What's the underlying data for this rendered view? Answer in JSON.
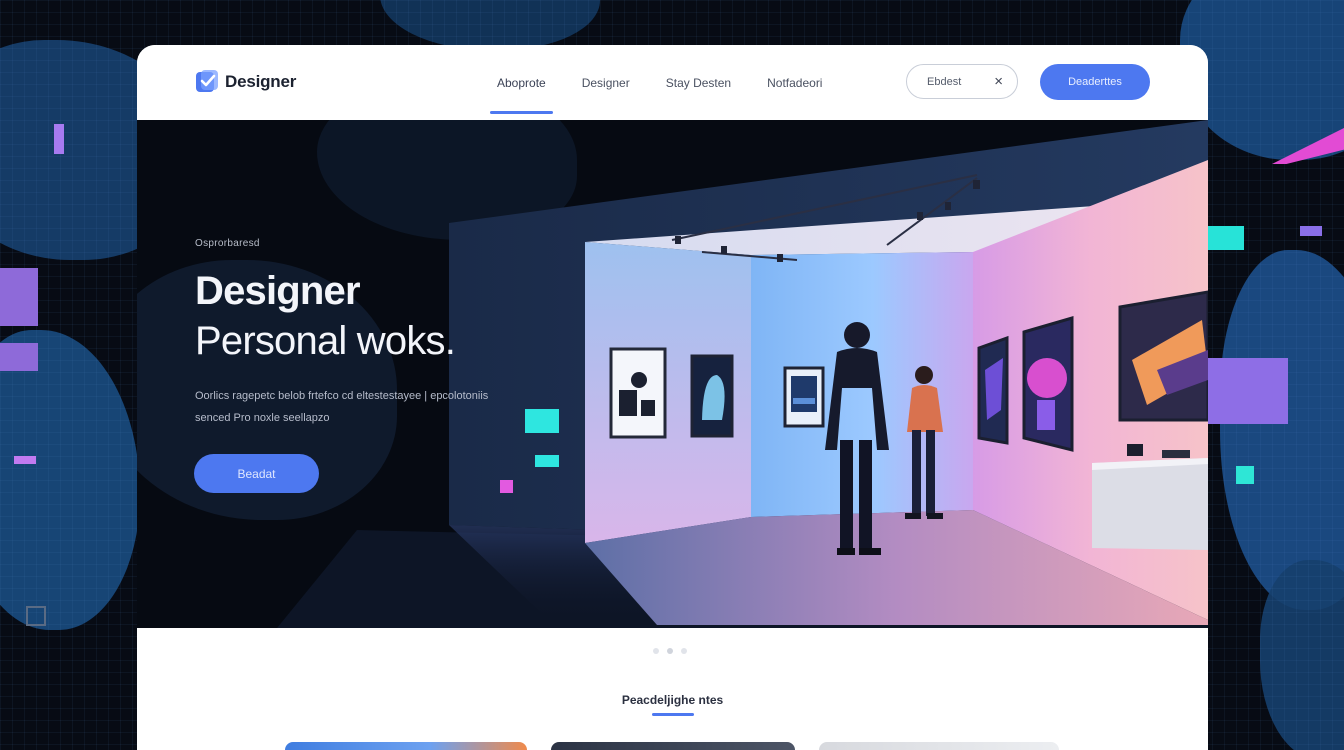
{
  "brand": {
    "name": "Designer",
    "accent_color": "#4d78f0",
    "logo_icon": "check-shield-icon"
  },
  "nav": {
    "links": [
      {
        "label": "Aboprote",
        "active": true
      },
      {
        "label": "Designer",
        "active": false
      },
      {
        "label": "Stay Desten",
        "active": false
      },
      {
        "label": "Notfadeori",
        "active": false
      }
    ],
    "search": {
      "value": "Ebdest",
      "clear_icon": "close-icon"
    },
    "cta_label": "Deaderttes"
  },
  "hero": {
    "eyebrow": "Osprorbaresd",
    "title_line1": "Designer",
    "title_line2": "Personal woks.",
    "description": "Oorlics ragepetc belob frtefco cd eltestestayee | epcolotoniis senced Pro noxle seellapzo",
    "button_label": "Beadat"
  },
  "carousel": {
    "count": 3,
    "active_index": 1
  },
  "section": {
    "title": "Peacdeljighe ntes"
  }
}
